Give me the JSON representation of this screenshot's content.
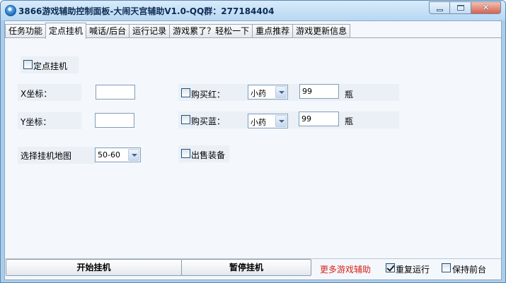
{
  "window": {
    "title": "3866游戏辅助控制面板-大闹天宫辅助V1.0-QQ群：277184404",
    "buttons": [
      "minimize",
      "maximize",
      "close"
    ]
  },
  "tabs": [
    {
      "label": "任务功能",
      "active": false
    },
    {
      "label": "定点挂机",
      "active": true
    },
    {
      "label": "喊话/后台",
      "active": false
    },
    {
      "label": "运行记录",
      "active": false
    },
    {
      "label": "游戏累了？轻松一下",
      "active": false
    },
    {
      "label": "重点推荐",
      "active": false
    },
    {
      "label": "游戏更新信息",
      "active": false
    }
  ],
  "form": {
    "fixed_point": {
      "label": "定点挂机",
      "checked": false
    },
    "x_label": "X坐标：",
    "x_value": "",
    "y_label": "Y坐标：",
    "y_value": "",
    "map_label": "选择挂机地图",
    "map_value": "50-60",
    "buy_red": {
      "label": "购买红：",
      "checked": false,
      "potion": "小药",
      "qty": "99",
      "unit": "瓶"
    },
    "buy_blue": {
      "label": "购买蓝：",
      "checked": false,
      "potion": "小药",
      "qty": "99",
      "unit": "瓶"
    },
    "sell_gear": {
      "label": "出售装备",
      "checked": false
    }
  },
  "bottom": {
    "start_label": "开始挂机",
    "pause_label": "暂停挂机",
    "more_link": "更多游戏辅助",
    "repeat": {
      "label": "重复运行",
      "checked": true
    },
    "foreground": {
      "label": "保持前台",
      "checked": false
    }
  },
  "colors": {
    "link": "#d6241d",
    "title_text": "#0d2b55"
  }
}
